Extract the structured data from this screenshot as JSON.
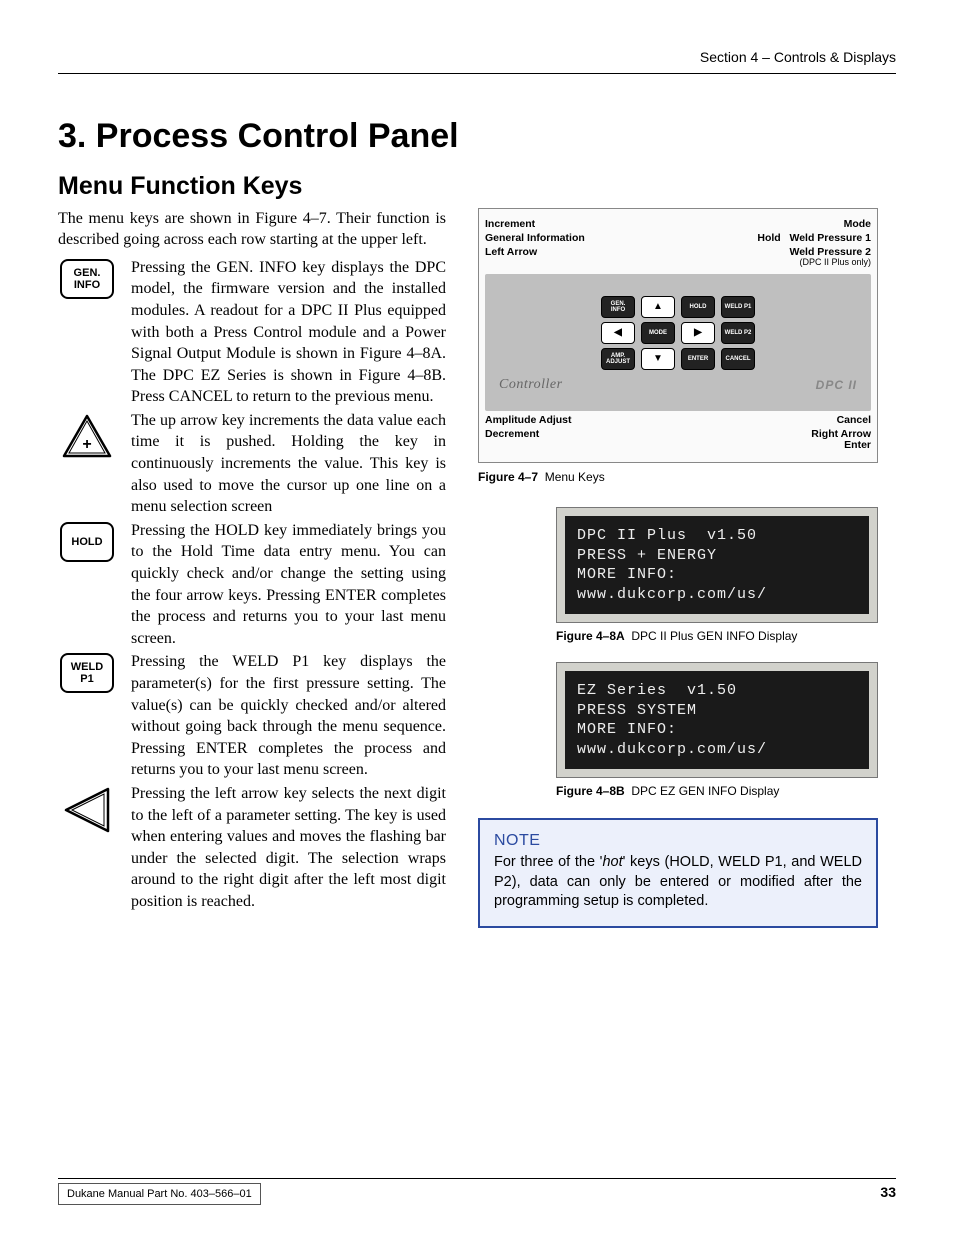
{
  "header": {
    "section": "Section 4 – Controls & Displays"
  },
  "titles": {
    "section": "3. Process Control Panel",
    "subsection": "Menu Function Keys"
  },
  "intro": "The menu keys are shown in Figure 4–7. Their function is described going across each row starting at the upper left.",
  "keys": [
    {
      "icon": "GEN.\nINFO",
      "icon_type": "box",
      "desc": "Pressing the GEN. INFO key displays the DPC model, the firmware version and the installed modules. A readout for a DPC II Plus equipped with both a Press Control module and a Power Signal Output Module is shown in Figure 4–8A. The DPC EZ Series is shown in Figure 4–8B. Press CANCEL to return to the previous menu."
    },
    {
      "icon": "+",
      "icon_type": "tri-up",
      "desc": "The up arrow key increments the data value each time it is pushed. Holding the key in continuously increments the value. This key is also used to move the cursor up one line on a menu selection screen"
    },
    {
      "icon": "HOLD",
      "icon_type": "box",
      "desc": "Pressing the HOLD key immediately brings you to the Hold Time data entry menu. You can quickly check and/or change the setting using the four arrow keys. Pressing ENTER completes the process and returns you to your last menu screen."
    },
    {
      "icon": "WELD\nP1",
      "icon_type": "box",
      "desc": "Pressing the WELD P1 key displays the parameter(s) for the first pressure setting. The value(s) can be quickly checked and/or altered without going back through the menu sequence. Pressing ENTER completes the process and returns you to your last menu screen."
    },
    {
      "icon": "",
      "icon_type": "tri-left",
      "desc": "Pressing the left arrow key selects the next digit to the left of a parameter setting. The key is used when entering values and moves the flashing bar under the selected digit. The selection wraps around to the right digit after the left most digit position is reached."
    }
  ],
  "fig7": {
    "caption_num": "Figure 4–7",
    "caption_text": "Menu Keys",
    "labels_top_left": [
      "Increment",
      "General Information",
      "Left Arrow"
    ],
    "labels_top_right": [
      "Mode",
      "Hold",
      "Weld Pressure 1",
      "Weld Pressure 2",
      "(DPC II Plus only)"
    ],
    "labels_bot_left": [
      "Amplitude Adjust",
      "Decrement"
    ],
    "labels_bot_right": [
      "Cancel",
      "Right Arrow",
      "Enter"
    ],
    "keypad_row1": [
      "GEN. INFO",
      "▲",
      "HOLD",
      "WELD P1"
    ],
    "keypad_row2": [
      "◀",
      "MODE",
      "▶",
      "WELD P2"
    ],
    "keypad_row3": [
      "AMP. ADJUST",
      "▼",
      "ENTER",
      "CANCEL"
    ],
    "controller_text": "Controller",
    "dpc_text": "DPC II"
  },
  "fig8a": {
    "lines": "DPC II Plus  v1.50\nPRESS + ENERGY\nMORE INFO:\nwww.dukcorp.com/us/",
    "caption_num": "Figure 4–8A",
    "caption_text": "DPC II Plus GEN INFO Display"
  },
  "fig8b": {
    "lines": "EZ Series  v1.50\nPRESS SYSTEM\nMORE INFO:\nwww.dukcorp.com/us/",
    "caption_num": "Figure 4–8B",
    "caption_text": "DPC EZ GEN INFO Display"
  },
  "note": {
    "title": "NOTE",
    "body_pre": "For three of the '",
    "body_em": "hot",
    "body_post": "' keys (HOLD, WELD P1, and WELD P2), data can only be entered or modified after the programming setup is completed."
  },
  "footer": {
    "left": "Dukane Manual Part No. 403–566–01",
    "page": "33"
  }
}
